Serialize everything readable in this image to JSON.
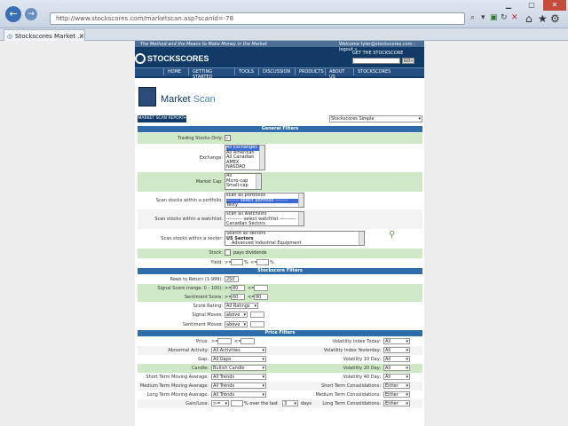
{
  "browser": {
    "url": "http://www.stockscores.com/marketscan.asp?scanid=-78",
    "tab_title": "Stockscores Market ...",
    "back": "←",
    "forward": "→"
  },
  "site": {
    "tagline": "The Method and the Means to Make Money in the Market",
    "welcome": "Welcome tyler@stockscores.com : logout »",
    "logo": "STOCKSCORES",
    "get_label": "GET THE STOCKSCORE",
    "go": "GO»",
    "nav": [
      "HOME",
      "GETTING STARTED",
      "TOOLS",
      "DISCUSSION",
      "PRODUCTS",
      "ABOUT US",
      "STOCKSCORES"
    ]
  },
  "page": {
    "title_main": "Market",
    "title_sub": "Scan",
    "report_btn": "MARKET SCAN REPORT▾",
    "view_select": "Stockscores Simple"
  },
  "general": {
    "header": "General Filters",
    "trading_only": "Trading Stocks Only:",
    "exchange_label": "Exchange:",
    "exchange_opts": [
      "All Exchanges",
      "All American",
      "All Canadian",
      "AMEX",
      "NASDAQ"
    ],
    "marketcap_label": "Market Cap:",
    "marketcap_opts": [
      "All",
      "Micro-cap",
      "Small-cap"
    ],
    "portfolio_label": "Scan stocks within a portfolio:",
    "portfolio_opts": [
      "scan all portfolios",
      "-------- select portfolio --------",
      "Testy"
    ],
    "watchlist_label": "Scan stocks within a watchlist:",
    "watchlist_opts": [
      "scan all watchlists",
      "---------- select watchlist ----------",
      "Canadian Sectors"
    ],
    "sector_label": "Scan stocks within a sector:",
    "sector_opts": [
      "Search all sectors",
      "US Sectors",
      "Advanced Industrial Equipment"
    ],
    "stock_label": "Stock:",
    "pays_div": "pays dividends",
    "yield_label": "Yield:",
    "gte": ">=",
    "lte": "<=",
    "pct": "%"
  },
  "ss": {
    "header": "Stockscore Filters",
    "rows_label": "Rows to Return (1-999):",
    "rows_val": "250",
    "signal_label": "Signal Score (range: 0 - 100):",
    "signal_min": "80",
    "sentiment_label": "Sentiment Score:",
    "sentiment_min": "60",
    "sentiment_max": "80",
    "rating_label": "Score Rating:",
    "rating_val": "All Ratings",
    "signal_moves_label": "Signal Moves:",
    "above": "above",
    "sentiment_moves_label": "Sentiment Moves:"
  },
  "price": {
    "header": "Price Filters",
    "left": [
      {
        "label": "Price:",
        "value": ""
      },
      {
        "label": "Abnormal Activity:",
        "value": "All Activities"
      },
      {
        "label": "Gap:",
        "value": "All Gaps"
      },
      {
        "label": "Candle:",
        "value": "Bullish Candle"
      },
      {
        "label": "Short Term Moving Average:",
        "value": "All Trends"
      },
      {
        "label": "Medium Term Moving Average:",
        "value": "All Trends"
      },
      {
        "label": "Long Term Moving Average:",
        "value": "All Trends"
      },
      {
        "label": "Gain/Loss:",
        "value": ">="
      }
    ],
    "right": [
      {
        "label": "Volatility Index Today:",
        "value": "All"
      },
      {
        "label": "Volatility Index Yesterday:",
        "value": "All"
      },
      {
        "label": "Volatility 10 Day:",
        "value": "All"
      },
      {
        "label": "Volatility 20 Day:",
        "value": "All"
      },
      {
        "label": "Volatility 40 Day:",
        "value": "All"
      },
      {
        "label": "Short Term Consolidations:",
        "value": "Either"
      },
      {
        "label": "Medium Term Consolidations:",
        "value": "Either"
      },
      {
        "label": "Long Term Consolidations:",
        "value": "Either"
      }
    ],
    "gain_over": "% over the last",
    "gain_days": "3",
    "days": "days"
  }
}
